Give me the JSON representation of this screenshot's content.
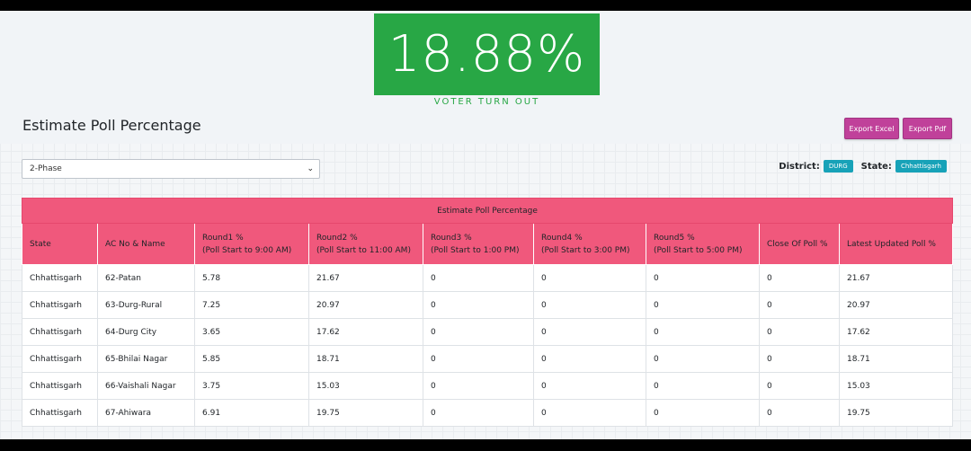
{
  "turnout": {
    "value": "18.88%",
    "label": "VOTER TURN OUT",
    "color": "#28a745"
  },
  "page_title": "Estimate Poll Percentage",
  "buttons": {
    "export_excel": "Export Excel",
    "export_pdf": "Export Pdf",
    "color": "#c0419a"
  },
  "phase_select": {
    "value": "2-Phase",
    "icon": "chevron-down-icon"
  },
  "filters": {
    "district_label": "District:",
    "district_value": "DURG",
    "state_label": "State:",
    "state_value": "Chhattisgarh",
    "tag_color": "#17a2b8"
  },
  "table": {
    "caption": "Estimate Poll Percentage",
    "header_color": "#f0587c",
    "headers": [
      {
        "line1": "State",
        "line2": ""
      },
      {
        "line1": "AC No & Name",
        "line2": ""
      },
      {
        "line1": "Round1 %",
        "line2": "(Poll Start to 9:00 AM)"
      },
      {
        "line1": "Round2 %",
        "line2": "(Poll Start to 11:00 AM)"
      },
      {
        "line1": "Round3 %",
        "line2": "(Poll Start to 1:00 PM)"
      },
      {
        "line1": "Round4 %",
        "line2": "(Poll Start to 3:00 PM)"
      },
      {
        "line1": "Round5 %",
        "line2": "(Poll Start to 5:00 PM)"
      },
      {
        "line1": "Close Of Poll %",
        "line2": ""
      },
      {
        "line1": "Latest Updated Poll %",
        "line2": ""
      }
    ],
    "rows": [
      [
        "Chhattisgarh",
        "62-Patan",
        "5.78",
        "21.67",
        "0",
        "0",
        "0",
        "0",
        "21.67"
      ],
      [
        "Chhattisgarh",
        "63-Durg-Rural",
        "7.25",
        "20.97",
        "0",
        "0",
        "0",
        "0",
        "20.97"
      ],
      [
        "Chhattisgarh",
        "64-Durg City",
        "3.65",
        "17.62",
        "0",
        "0",
        "0",
        "0",
        "17.62"
      ],
      [
        "Chhattisgarh",
        "65-Bhilai Nagar",
        "5.85",
        "18.71",
        "0",
        "0",
        "0",
        "0",
        "18.71"
      ],
      [
        "Chhattisgarh",
        "66-Vaishali Nagar",
        "3.75",
        "15.03",
        "0",
        "0",
        "0",
        "0",
        "15.03"
      ],
      [
        "Chhattisgarh",
        "67-Ahiwara",
        "6.91",
        "19.75",
        "0",
        "0",
        "0",
        "0",
        "19.75"
      ]
    ]
  }
}
